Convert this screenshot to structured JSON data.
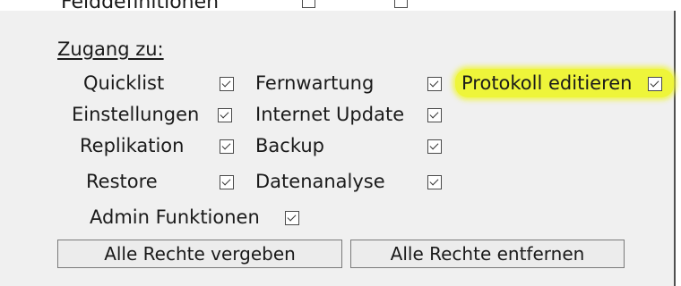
{
  "previous_row": {
    "label": "Felddefinitionen"
  },
  "section": {
    "heading": "Zugang zu:"
  },
  "permissions": [
    {
      "label": "Quicklist",
      "checked": true
    },
    {
      "label": "Fernwartung",
      "checked": true
    },
    {
      "label": "Protokoll editieren",
      "checked": true,
      "highlighted": true,
      "highlight_color": "#eef53a"
    },
    {
      "label": "Einstellungen",
      "checked": true
    },
    {
      "label": "Internet Update",
      "checked": true
    },
    {
      "label": "Replikation",
      "checked": true
    },
    {
      "label": "Backup",
      "checked": true
    },
    {
      "label": "Restore",
      "checked": true
    },
    {
      "label": "Datenanalyse",
      "checked": true
    },
    {
      "label": "Admin Funktionen",
      "checked": true
    }
  ],
  "buttons": {
    "grant_all": "Alle Rechte vergeben",
    "revoke_all": "Alle Rechte entfernen"
  },
  "colors": {
    "panel_bg": "#f0f0f0",
    "highlight": "#eef53a"
  }
}
